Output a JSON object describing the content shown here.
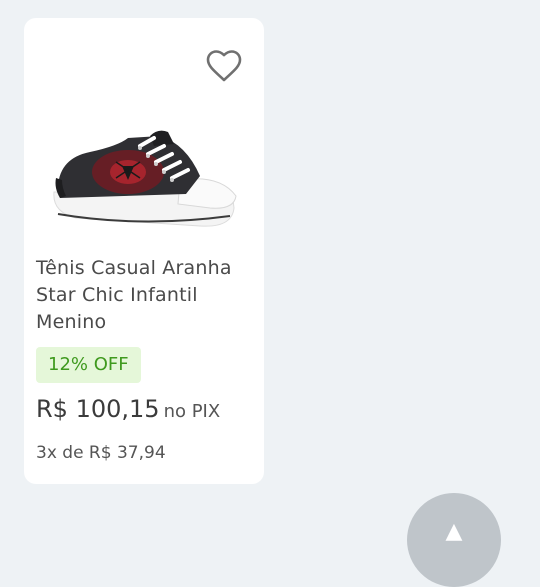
{
  "product": {
    "image_alt": "sneaker-product-image",
    "title": "Tênis Casual Aranha Star Chic Infantil Menino",
    "discount_badge": "12% OFF",
    "price": "R$ 100,15",
    "price_suffix": "no PIX",
    "installments": "3x de R$ 37,94",
    "favorite_icon": "heart-outline-icon"
  },
  "fab": {
    "icon": "chevron-up-icon"
  },
  "colors": {
    "background": "#eef2f5",
    "card": "#ffffff",
    "badge_bg": "#e5f7d9",
    "badge_text": "#3f9a1e",
    "fab": "#bfc5ca"
  }
}
